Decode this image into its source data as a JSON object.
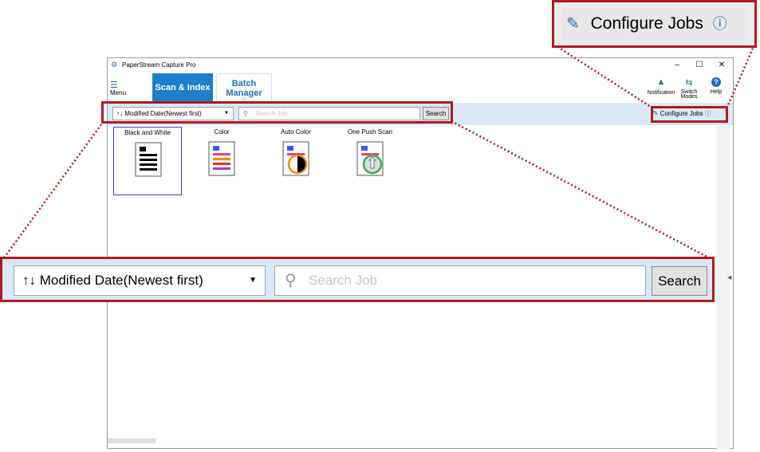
{
  "window": {
    "title": "PaperStream Capture Pro",
    "controls": {
      "minimize": "–",
      "maximize": "☐",
      "close": "✕"
    }
  },
  "ribbon": {
    "menu_label": "Menu",
    "tabs": [
      {
        "label": "Scan & Index",
        "active": true
      },
      {
        "label": "Batch Manager",
        "active": false
      }
    ],
    "right_buttons": [
      {
        "label": "Notification",
        "icon": "bell-icon"
      },
      {
        "label": "Switch Modes",
        "icon": "switch-modes-icon"
      },
      {
        "label": "Help",
        "icon": "help-icon"
      }
    ]
  },
  "toolbar": {
    "sort_value": "Modified Date(Newest first)",
    "search_placeholder": "Search Job",
    "search_button": "Search",
    "configure_jobs": "Configure Jobs"
  },
  "jobs": [
    {
      "label": "Black and White",
      "selected": true
    },
    {
      "label": "Color",
      "selected": false
    },
    {
      "label": "Auto Color",
      "selected": false
    },
    {
      "label": "One Push Scan",
      "selected": false
    }
  ],
  "zoom": {
    "configure_jobs": "Configure Jobs",
    "sort_value": "Modified Date(Newest first)",
    "search_placeholder": "Search Job",
    "search_button": "Search"
  },
  "colors": {
    "accent": "#1d7fc7",
    "highlight": "#b3191f",
    "toolbar_bg": "#d8e8f5"
  }
}
